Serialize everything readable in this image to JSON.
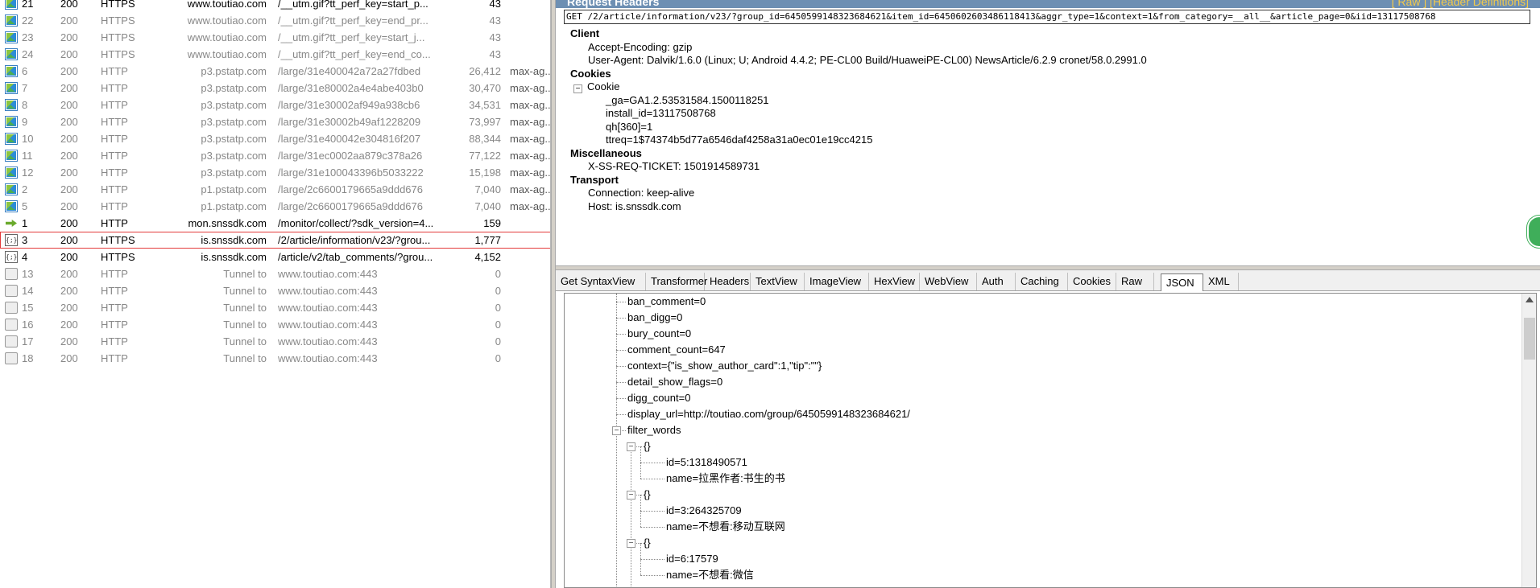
{
  "sessions": [
    {
      "icon": "image-icon",
      "num": "21",
      "result": "200",
      "protocol": "HTTPS",
      "host": "www.toutiao.com",
      "url": "/__utm.gif?tt_perf_key=start_p...",
      "body": "43",
      "caching": "",
      "style": "dark"
    },
    {
      "icon": "image-icon",
      "num": "22",
      "result": "200",
      "protocol": "HTTPS",
      "host": "www.toutiao.com",
      "url": "/__utm.gif?tt_perf_key=end_pr...",
      "body": "43",
      "caching": "",
      "style": "gray"
    },
    {
      "icon": "image-icon",
      "num": "23",
      "result": "200",
      "protocol": "HTTPS",
      "host": "www.toutiao.com",
      "url": "/__utm.gif?tt_perf_key=start_j...",
      "body": "43",
      "caching": "",
      "style": "gray"
    },
    {
      "icon": "image-icon",
      "num": "24",
      "result": "200",
      "protocol": "HTTPS",
      "host": "www.toutiao.com",
      "url": "/__utm.gif?tt_perf_key=end_co...",
      "body": "43",
      "caching": "",
      "style": "gray"
    },
    {
      "icon": "image-icon",
      "num": "6",
      "result": "200",
      "protocol": "HTTP",
      "host": "p3.pstatp.com",
      "url": "/large/31e400042a72a27fdbed",
      "body": "26,412",
      "caching": "max-ag...",
      "style": "gray"
    },
    {
      "icon": "image-icon",
      "num": "7",
      "result": "200",
      "protocol": "HTTP",
      "host": "p3.pstatp.com",
      "url": "/large/31e80002a4e4abe403b0",
      "body": "30,470",
      "caching": "max-ag...",
      "style": "gray"
    },
    {
      "icon": "image-icon",
      "num": "8",
      "result": "200",
      "protocol": "HTTP",
      "host": "p3.pstatp.com",
      "url": "/large/31e30002af949a938cb6",
      "body": "34,531",
      "caching": "max-ag...",
      "style": "gray"
    },
    {
      "icon": "image-icon",
      "num": "9",
      "result": "200",
      "protocol": "HTTP",
      "host": "p3.pstatp.com",
      "url": "/large/31e30002b49af1228209",
      "body": "73,997",
      "caching": "max-ag...",
      "style": "gray"
    },
    {
      "icon": "image-icon",
      "num": "10",
      "result": "200",
      "protocol": "HTTP",
      "host": "p3.pstatp.com",
      "url": "/large/31e400042e304816f207",
      "body": "88,344",
      "caching": "max-ag...",
      "style": "gray"
    },
    {
      "icon": "image-icon",
      "num": "11",
      "result": "200",
      "protocol": "HTTP",
      "host": "p3.pstatp.com",
      "url": "/large/31ec0002aa879c378a26",
      "body": "77,122",
      "caching": "max-ag...",
      "style": "gray"
    },
    {
      "icon": "image-icon",
      "num": "12",
      "result": "200",
      "protocol": "HTTP",
      "host": "p3.pstatp.com",
      "url": "/large/31e100043396b5033222",
      "body": "15,198",
      "caching": "max-ag...",
      "style": "gray"
    },
    {
      "icon": "image-icon",
      "num": "2",
      "result": "200",
      "protocol": "HTTP",
      "host": "p1.pstatp.com",
      "url": "/large/2c6600179665a9ddd676",
      "body": "7,040",
      "caching": "max-ag...",
      "style": "gray"
    },
    {
      "icon": "image-icon",
      "num": "5",
      "result": "200",
      "protocol": "HTTP",
      "host": "p1.pstatp.com",
      "url": "/large/2c6600179665a9ddd676",
      "body": "7,040",
      "caching": "max-ag...",
      "style": "gray"
    },
    {
      "icon": "arrow-icon",
      "num": "1",
      "result": "200",
      "protocol": "HTTP",
      "host": "mon.snssdk.com",
      "url": "/monitor/collect/?sdk_version=4...",
      "body": "159",
      "caching": "",
      "style": "dark"
    },
    {
      "icon": "json-icon",
      "num": "3",
      "result": "200",
      "protocol": "HTTPS",
      "host": "is.snssdk.com",
      "url": "/2/article/information/v23/?grou...",
      "body": "1,777",
      "caching": "",
      "style": "dark",
      "selected": true
    },
    {
      "icon": "json-icon",
      "num": "4",
      "result": "200",
      "protocol": "HTTPS",
      "host": "is.snssdk.com",
      "url": "/article/v2/tab_comments/?grou...",
      "body": "4,152",
      "caching": "",
      "style": "dark"
    },
    {
      "icon": "lock-icon",
      "num": "13",
      "result": "200",
      "protocol": "HTTP",
      "host": "Tunnel to",
      "url": "www.toutiao.com:443",
      "body": "0",
      "caching": "",
      "style": "gray"
    },
    {
      "icon": "lock-icon",
      "num": "14",
      "result": "200",
      "protocol": "HTTP",
      "host": "Tunnel to",
      "url": "www.toutiao.com:443",
      "body": "0",
      "caching": "",
      "style": "gray"
    },
    {
      "icon": "lock-icon",
      "num": "15",
      "result": "200",
      "protocol": "HTTP",
      "host": "Tunnel to",
      "url": "www.toutiao.com:443",
      "body": "0",
      "caching": "",
      "style": "gray"
    },
    {
      "icon": "lock-icon",
      "num": "16",
      "result": "200",
      "protocol": "HTTP",
      "host": "Tunnel to",
      "url": "www.toutiao.com:443",
      "body": "0",
      "caching": "",
      "style": "gray"
    },
    {
      "icon": "lock-icon",
      "num": "17",
      "result": "200",
      "protocol": "HTTP",
      "host": "Tunnel to",
      "url": "www.toutiao.com:443",
      "body": "0",
      "caching": "",
      "style": "gray"
    },
    {
      "icon": "lock-icon",
      "num": "18",
      "result": "200",
      "protocol": "HTTP",
      "host": "Tunnel to",
      "url": "www.toutiao.com:443",
      "body": "0",
      "caching": "",
      "style": "gray"
    }
  ],
  "request": {
    "title": "Request Headers",
    "links": "[ Raw ]   [Header Definitions]",
    "line": "GET /2/article/information/v23/?group_id=6450599148323684621&item_id=6450602603486118413&aggr_type=1&context=1&from_category=__all__&article_page=0&iid=13117508768",
    "headers": [
      {
        "text": "Client",
        "kind": "section"
      },
      {
        "text": "Accept-Encoding: gzip",
        "kind": "item"
      },
      {
        "text": "User-Agent: Dalvik/1.6.0 (Linux; U; Android 4.4.2; PE-CL00 Build/HuaweiPE-CL00) NewsArticle/6.2.9 cronet/58.0.2991.0",
        "kind": "item"
      },
      {
        "text": "Cookies",
        "kind": "section"
      },
      {
        "text": "Cookie",
        "kind": "toggle"
      },
      {
        "text": "_ga=GA1.2.53531584.1500118251",
        "kind": "sub"
      },
      {
        "text": "install_id=13117508768",
        "kind": "sub"
      },
      {
        "text": "qh[360]=1",
        "kind": "sub"
      },
      {
        "text": "ttreq=1$74374b5d77a6546daf4258a31a0ec01e19cc4215",
        "kind": "sub"
      },
      {
        "text": "Miscellaneous",
        "kind": "section"
      },
      {
        "text": "X-SS-REQ-TICKET: 1501914589731",
        "kind": "item"
      },
      {
        "text": "Transport",
        "kind": "section"
      },
      {
        "text": "Connection: keep-alive",
        "kind": "item"
      },
      {
        "text": "Host: is.snssdk.com",
        "kind": "item"
      }
    ]
  },
  "tabs": [
    "Get SyntaxView",
    "Transformer",
    "Headers",
    "TextView",
    "ImageView",
    "HexView",
    "WebView",
    "Auth",
    "Caching",
    "Cookies",
    "Raw",
    "JSON",
    "XML"
  ],
  "active_tab": "JSON",
  "json_tree": [
    {
      "text": "ban_comment=0",
      "level": 0
    },
    {
      "text": "ban_digg=0",
      "level": 0
    },
    {
      "text": "bury_count=0",
      "level": 0
    },
    {
      "text": "comment_count=647",
      "level": 0
    },
    {
      "text": "context={\"is_show_author_card\":1,\"tip\":\"\"}",
      "level": 0
    },
    {
      "text": "detail_show_flags=0",
      "level": 0
    },
    {
      "text": "digg_count=0",
      "level": 0
    },
    {
      "text": "display_url=http://toutiao.com/group/6450599148323684621/",
      "level": 0
    },
    {
      "text": "filter_words",
      "level": 0,
      "toggle": "−"
    },
    {
      "text": "{}",
      "level": 1,
      "toggle": "−"
    },
    {
      "text": "id=5:1318490571",
      "level": 2
    },
    {
      "text": "name=拉黑作者:书生的书",
      "level": 2
    },
    {
      "text": "{}",
      "level": 1,
      "toggle": "−"
    },
    {
      "text": "id=3:264325709",
      "level": 2
    },
    {
      "text": "name=不想看:移动互联网",
      "level": 2
    },
    {
      "text": "{}",
      "level": 1,
      "toggle": "−"
    },
    {
      "text": "id=6:17579",
      "level": 2
    },
    {
      "text": "name=不想看:微信",
      "level": 2
    }
  ],
  "colors": {
    "accent": "#6d8fb3",
    "selection_border": "#e43a3a",
    "tab_bg": "#f0f0f0"
  }
}
